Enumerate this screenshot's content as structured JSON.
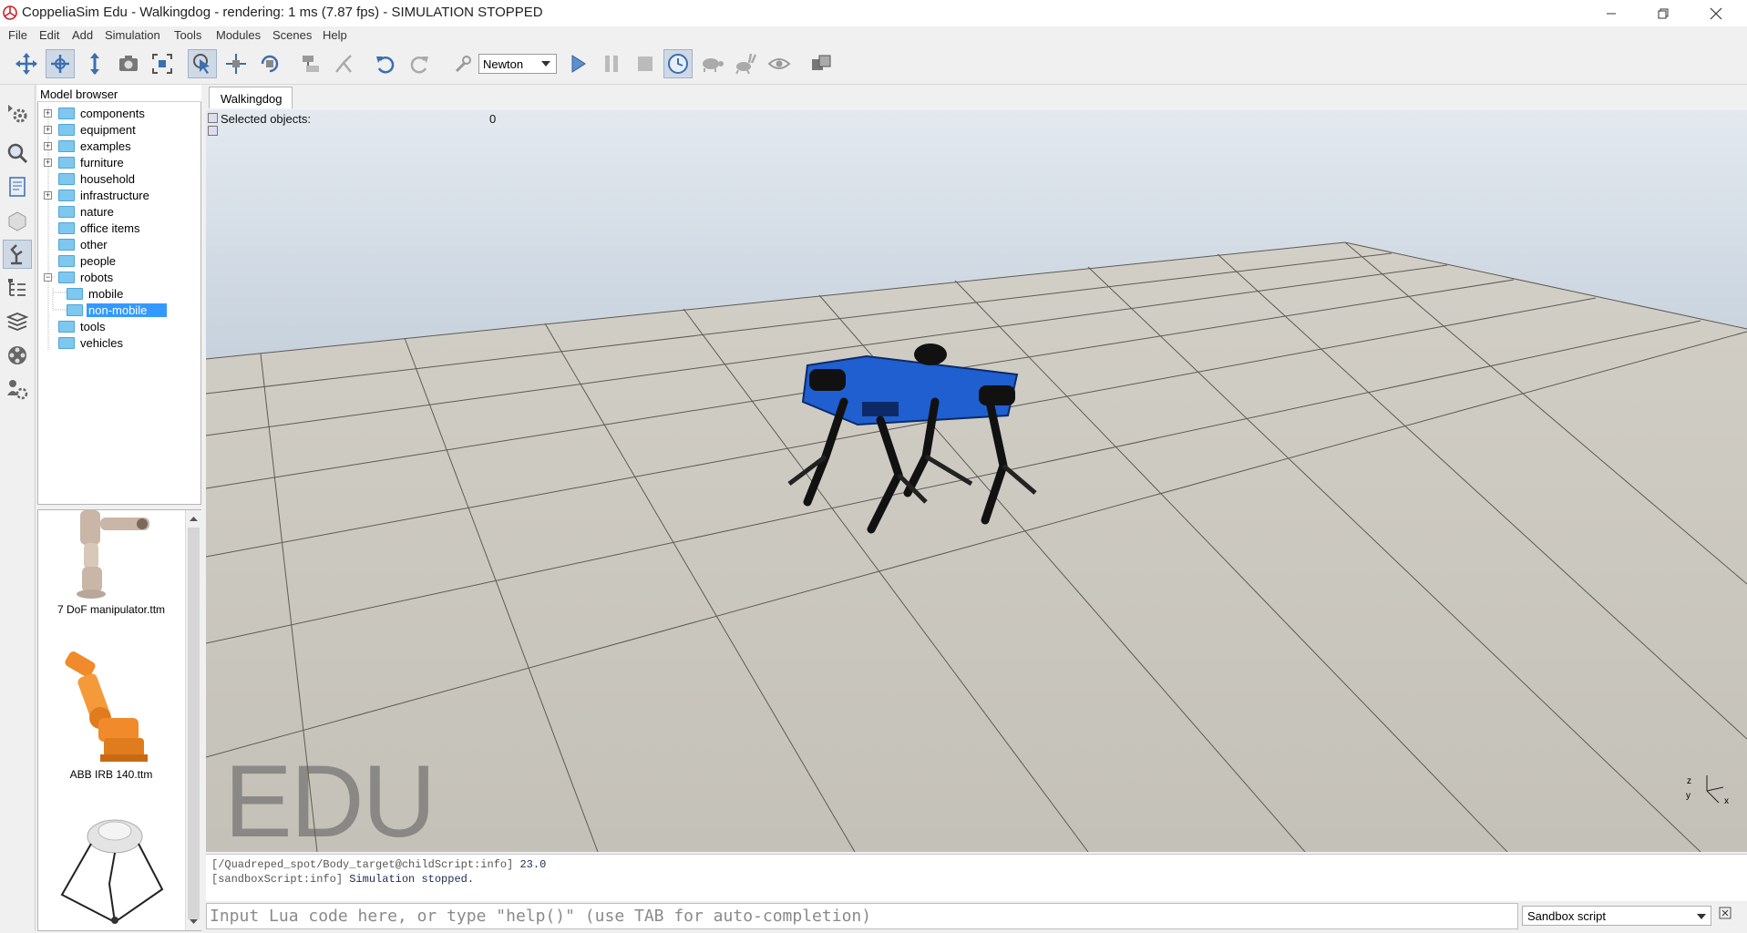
{
  "window": {
    "title": "CoppeliaSim Edu - Walkingdog - rendering: 1 ms (7.87 fps) - SIMULATION STOPPED",
    "controls": [
      "minimize",
      "restore",
      "close"
    ]
  },
  "menu": [
    "File",
    "Edit",
    "Add",
    "Simulation",
    "Tools",
    "Modules",
    "Scenes",
    "Help"
  ],
  "toolbar": {
    "physics_engine": "Newton",
    "buttons": [
      "camera-pan",
      "camera-rotate",
      "camera-shift",
      "camera-angle",
      "fit-to-view",
      "object-select",
      "object-shift",
      "object-rotate",
      "assemble",
      "transfer-dna",
      "undo",
      "redo",
      "dynamic-content",
      "start-simulation",
      "pause-simulation",
      "stop-simulation",
      "real-time",
      "slow-down",
      "speed-up",
      "visualization",
      "page-selector"
    ]
  },
  "model_browser": {
    "header": "Model browser",
    "items": [
      {
        "label": "components",
        "expandable": true,
        "level": 0
      },
      {
        "label": "equipment",
        "expandable": true,
        "level": 0
      },
      {
        "label": "examples",
        "expandable": true,
        "level": 0
      },
      {
        "label": "furniture",
        "expandable": true,
        "level": 0
      },
      {
        "label": "household",
        "expandable": false,
        "level": 0
      },
      {
        "label": "infrastructure",
        "expandable": true,
        "level": 0
      },
      {
        "label": "nature",
        "expandable": false,
        "level": 0
      },
      {
        "label": "office items",
        "expandable": false,
        "level": 0
      },
      {
        "label": "other",
        "expandable": false,
        "level": 0
      },
      {
        "label": "people",
        "expandable": false,
        "level": 0
      },
      {
        "label": "robots",
        "expandable": true,
        "expanded": true,
        "level": 0
      },
      {
        "label": "mobile",
        "expandable": false,
        "level": 1
      },
      {
        "label": "non-mobile",
        "expandable": false,
        "level": 1,
        "selected": true
      },
      {
        "label": "tools",
        "expandable": false,
        "level": 0
      },
      {
        "label": "vehicles",
        "expandable": false,
        "level": 0
      }
    ]
  },
  "thumbnails": [
    {
      "caption": "7 DoF manipulator.ttm"
    },
    {
      "caption": "ABB IRB 140.ttm"
    },
    {
      "caption": ""
    }
  ],
  "scene_tabs": [
    "Walkingdog"
  ],
  "viewport": {
    "selected_label": "Selected objects:",
    "selected_count": "0",
    "watermark": "EDU",
    "axis_labels": {
      "z": "z",
      "y": "y",
      "x": "x"
    }
  },
  "console": {
    "lines": [
      {
        "source": "[/Quadreped_spot/Body_target@childScript:info]",
        "message": "23.0"
      },
      {
        "source": "[sandboxScript:info]",
        "message": "Simulation stopped."
      }
    ],
    "input_placeholder": "Input Lua code here, or type \"help()\" (use TAB for auto-completion)",
    "script_selector": "Sandbox script"
  },
  "colors": {
    "robot_body": "#1f5fd0",
    "selection": "#3399ff",
    "folder": "#7ec8f0"
  }
}
